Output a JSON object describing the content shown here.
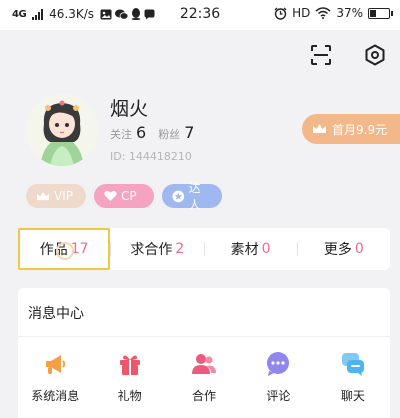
{
  "status_bar": {
    "network": "4G",
    "speed": "46.3K/s",
    "time": "22:36",
    "hd": "HD",
    "battery": "37%",
    "battery_level": 0.37
  },
  "profile": {
    "name": "烟火",
    "following_label": "关注",
    "following_count": "6",
    "fans_label": "粉丝",
    "fans_count": "7",
    "id_text": "ID: 144418210",
    "vip_banner": "首月9.9元"
  },
  "badges": [
    {
      "label": "VIP",
      "color": "#eed9cb"
    },
    {
      "label": "CP",
      "color": "#f6a3c1"
    },
    {
      "label": "达人",
      "color": "#9fb9f0"
    }
  ],
  "tabs": [
    {
      "label": "作品",
      "count": "17"
    },
    {
      "label": "求合作",
      "count": "2"
    },
    {
      "label": "素材",
      "count": "0"
    },
    {
      "label": "更多",
      "count": "0"
    }
  ],
  "messages": {
    "title": "消息中心",
    "items": [
      {
        "label": "系统消息",
        "icon": "megaphone-icon",
        "color": "#f4a043"
      },
      {
        "label": "礼物",
        "icon": "gift-icon",
        "color": "#f0566a"
      },
      {
        "label": "合作",
        "icon": "people-icon",
        "color": "#ee5a7e"
      },
      {
        "label": "评论",
        "icon": "comment-icon",
        "color": "#8f86ee"
      },
      {
        "label": "聊天",
        "icon": "chat-icon",
        "color": "#4fb3f0"
      }
    ]
  },
  "colors": {
    "accent_count": "#f06a8a",
    "vip_banner": "#f3b889",
    "active_outline": "#f0c848"
  }
}
